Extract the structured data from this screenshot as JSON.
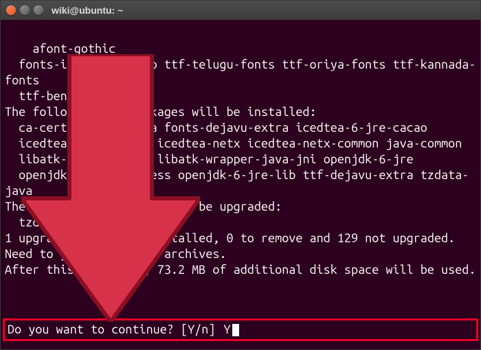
{
  "window": {
    "title": "wiki@ubuntu: ~"
  },
  "terminal": {
    "text": "afont-gothic\n  fonts-ipafont-mincho ttf-telugu-fonts ttf-oriya-fonts ttf-kannada-fonts\n  ttf-bengali-fonts\nThe following NEW packages will be installed:\n  ca-certificates-java fonts-dejavu-extra icedtea-6-jre-cacao\n  icedtea-6-jre-jamvm icedtea-netx icedtea-netx-common java-common\n  libatk-wrapper-java libatk-wrapper-java-jni openjdk-6-jre\n  openjdk-6-jre-headless openjdk-6-jre-lib ttf-dejavu-extra tzdata-java\nThe following packages will be upgraded:\n  tzdata\n1 upgraded, 14 newly installed, 0 to remove and 129 not upgraded.\nNeed to get 42.8 MB of archives.\nAfter this operation, 73.2 MB of additional disk space will be used."
  },
  "prompt": {
    "question": "Do you want to continue? [Y/n] ",
    "input": "Y"
  }
}
